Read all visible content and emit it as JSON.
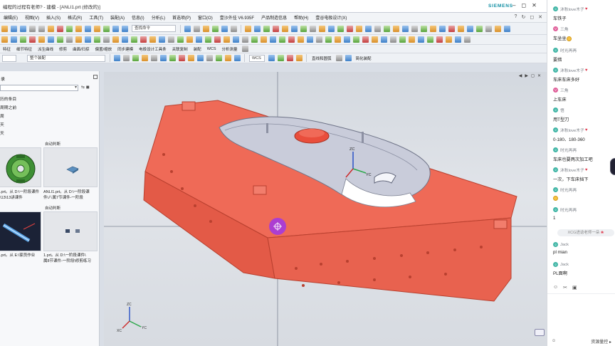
{
  "app": {
    "title": "编程的过程有老师? - 建模 - [ANLI1.prt (修改的)]",
    "brand": "SIEMENS",
    "window_controls": [
      "–",
      "◻",
      "✕"
    ]
  },
  "menu": {
    "items": [
      "编辑(E)",
      "视图(V)",
      "插入(S)",
      "格式(R)",
      "工具(T)",
      "装配(A)",
      "信息(I)",
      "分析(L)",
      "首选项(P)",
      "窗口(O)",
      "壹沙外挂 V6.935F",
      "产品制造信息",
      "帮助(H)",
      "壹谷电极设计(X)"
    ],
    "right_icons": [
      "?",
      "↻",
      "◻",
      "✕"
    ]
  },
  "toolbar": {
    "command_search_placeholder": "查找命令",
    "row3_labels": [
      "特征",
      "细节特征",
      "派生曲线",
      "修剪",
      "曲面/扫掠",
      "偏置/缩放",
      "同步建模",
      "电极设计工具条",
      "关联复制",
      "装配",
      "WCS",
      "分析测量"
    ],
    "filter_dropdown": "整个装配",
    "wcs_label": "WCS",
    "snap_mode": "直线和圆弧",
    "simplify_label": "简化装配"
  },
  "resource_panel": {
    "title": "录",
    "history": [
      "历的条目",
      "周期之前",
      "周",
      "天",
      "天"
    ],
    "thumbs": [
      {
        "header": "",
        "caption_line1": ".prt。从 D:\\一阶段课件",
        "caption_line2": "\\13\\13讲课件"
      },
      {
        "header": "自动判断",
        "caption_line1": "ANLI1.prt。从 D:\\一阶段课",
        "caption_line2": "件\\八属7节课件-一阶段"
      },
      {
        "header": "",
        "caption_line1": ".prt。从 E:\\家员作业",
        "caption_line2": ""
      },
      {
        "header": "自动判断",
        "caption_line1": "1.prt。从 D:\\一阶段课件\\",
        "caption_line2": "属8节课件-一阶段\\修剪练习"
      }
    ]
  },
  "viewport": {
    "controls": [
      "◀",
      "▶",
      "◻",
      "✕"
    ],
    "axis_labels": {
      "x": "XC",
      "y": "YC",
      "z": "ZC"
    }
  },
  "chat": {
    "messages": [
      {
        "user": "沐秋love木子",
        "heart": true,
        "text": "车铁子",
        "avatar_color": "#3fb5a5"
      },
      {
        "user": "三角",
        "heart": false,
        "text": "车坐坐",
        "emoji": true,
        "avatar_color": "#e0609a"
      },
      {
        "user": "时光再再",
        "heart": false,
        "text": "要措",
        "avatar_color": "#3fb5a5"
      },
      {
        "user": "沐秋love木子",
        "heart": true,
        "text": "车床车床多好",
        "avatar_color": "#3fb5a5"
      },
      {
        "user": "三角",
        "heart": false,
        "text": "上车床",
        "avatar_color": "#e0609a"
      },
      {
        "user": "悟",
        "heart": false,
        "text": "用T型刀",
        "avatar_color": "#3fb5a5"
      },
      {
        "user": "沐秋love木子",
        "heart": true,
        "text": "0-180、180-360",
        "avatar_color": "#3fb5a5"
      },
      {
        "user": "时光再再",
        "heart": false,
        "text": "车床也要两次加工吧",
        "avatar_color": "#3fb5a5"
      },
      {
        "user": "沐秋love木子",
        "heart": true,
        "text": "一次，下车床挡下",
        "avatar_color": "#3fb5a5"
      },
      {
        "user": "时光再再",
        "heart": false,
        "text": "",
        "emoji": true,
        "avatar_color": "#3fb5a5"
      },
      {
        "user": "时光再再",
        "heart": false,
        "text": "1",
        "avatar_color": "#3fb5a5"
      },
      {
        "user": "Jack",
        "heart": false,
        "text": "pl mian",
        "avatar_color": "#3fb5a5"
      },
      {
        "user": "Jack",
        "heart": false,
        "text": "PL面啊",
        "avatar_color": "#3fb5a5"
      }
    ],
    "system_note": "XCG进谂老师一朵",
    "tools": [
      "☺",
      "✂",
      "▣"
    ],
    "send_label": "发送",
    "send_extra": "资源量控"
  }
}
